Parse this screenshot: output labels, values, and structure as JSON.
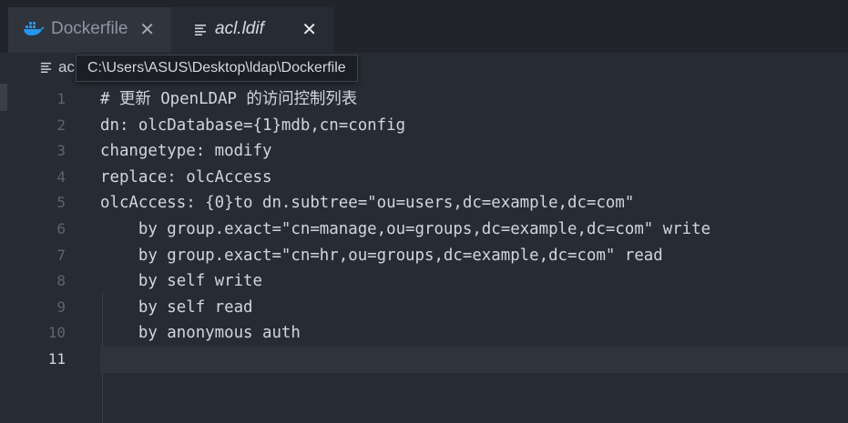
{
  "tabs": [
    {
      "label": "Dockerfile",
      "icon": "docker-icon",
      "active": false
    },
    {
      "label": "acl.ldif",
      "icon": "text-file-icon",
      "active": true
    }
  ],
  "close_glyph": "✕",
  "breadcrumb": {
    "label": "acl.ldif",
    "visible_label": "ac"
  },
  "tooltip": "C:\\Users\\ASUS\\Desktop\\ldap\\Dockerfile",
  "editor": {
    "current_line": 11,
    "lines": [
      {
        "n": "1",
        "text": "# 更新 OpenLDAP 的访问控制列表"
      },
      {
        "n": "2",
        "text": "dn: olcDatabase={1}mdb,cn=config"
      },
      {
        "n": "3",
        "text": "changetype: modify"
      },
      {
        "n": "4",
        "text": "replace: olcAccess"
      },
      {
        "n": "5",
        "text": "olcAccess: {0}to dn.subtree=\"ou=users,dc=example,dc=com\""
      },
      {
        "n": "6",
        "text": "    by group.exact=\"cn=manage,ou=groups,dc=example,dc=com\" write"
      },
      {
        "n": "7",
        "text": "    by group.exact=\"cn=hr,ou=groups,dc=example,dc=com\" read"
      },
      {
        "n": "8",
        "text": "    by self write"
      },
      {
        "n": "9",
        "text": "    by self read"
      },
      {
        "n": "10",
        "text": "    by anonymous auth"
      },
      {
        "n": "11",
        "text": ""
      }
    ]
  },
  "colors": {
    "docker_blue": "#2496ed",
    "editor_bg": "#272c34",
    "tabbar_bg": "#21252b"
  }
}
